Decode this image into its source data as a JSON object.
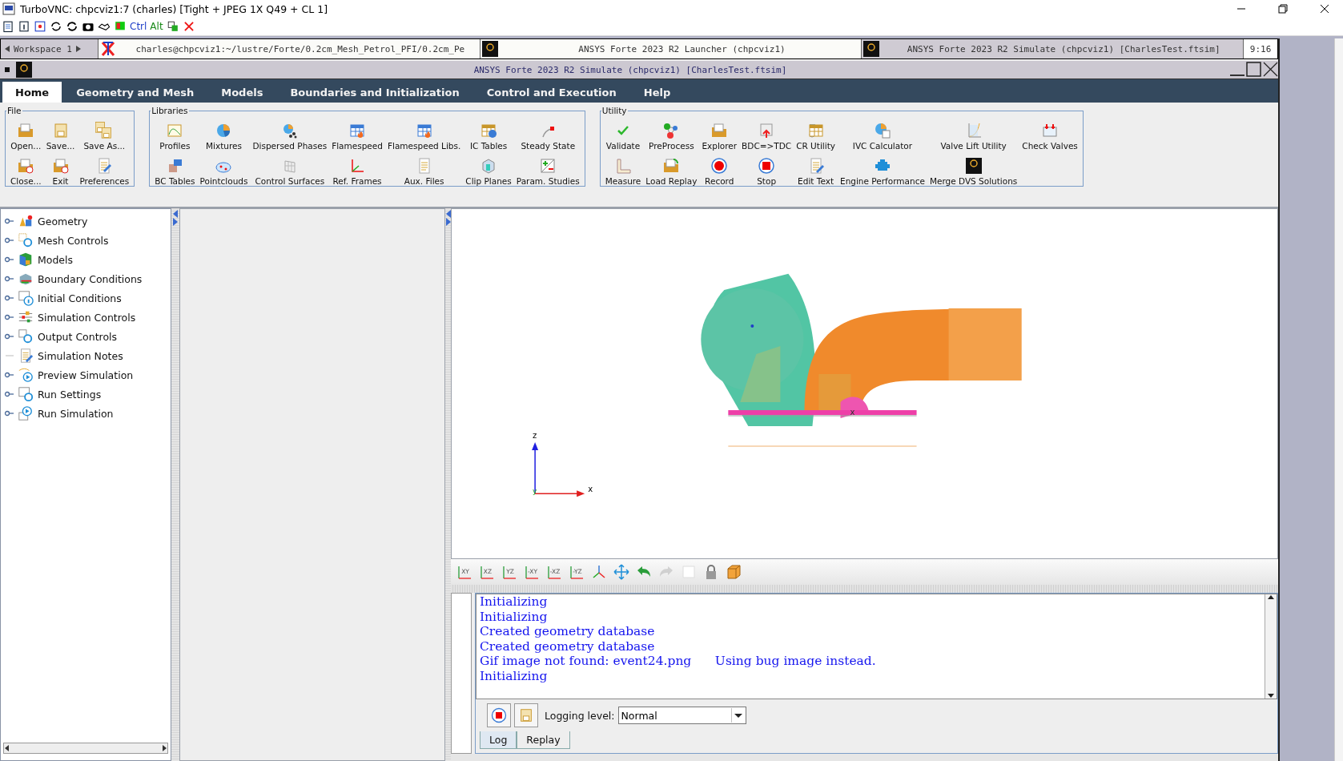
{
  "vnc_window": {
    "title": "TurboVNC: chpcviz1:7 (charles) [Tight + JPEG 1X Q49 + CL 1]",
    "toolbar_keys": [
      "Ctrl",
      "Alt"
    ]
  },
  "taskbar": {
    "workspace": "Workspace 1",
    "tasks": [
      {
        "label": "charles@chpcviz1:~/lustre/Forte/0.2cm_Mesh_Petrol_PFI/0.2cm_Pe",
        "selected": false
      },
      {
        "label": "ANSYS Forte 2023 R2 Launcher (chpcviz1)",
        "selected": false
      },
      {
        "label": "ANSYS Forte 2023 R2 Simulate (chpcviz1)  [CharlesTest.ftsim]",
        "selected": true
      }
    ],
    "clock": "9:16"
  },
  "app_window": {
    "title": "ANSYS Forte 2023 R2 Simulate (chpcviz1)  [CharlesTest.ftsim]"
  },
  "menu": [
    {
      "label": "Home",
      "selected": true
    },
    {
      "label": "Geometry and Mesh",
      "selected": false
    },
    {
      "label": "Models",
      "selected": false
    },
    {
      "label": "Boundaries and Initialization",
      "selected": false
    },
    {
      "label": "Control and Execution",
      "selected": false
    },
    {
      "label": "Help",
      "selected": false
    }
  ],
  "ribbon": [
    {
      "title": "File",
      "items": [
        "Open...",
        "Save...",
        "Save As...",
        "Close...",
        "Exit",
        "Preferences"
      ]
    },
    {
      "title": "Libraries",
      "items": [
        "Profiles",
        "Mixtures",
        "Dispersed Phases",
        "Flamespeed",
        "Flamespeed Libs.",
        "IC Tables",
        "Steady State",
        "BC Tables",
        "Pointclouds",
        "Control Surfaces",
        "Ref. Frames",
        "Aux. Files",
        "Clip Planes",
        "Param. Studies"
      ]
    },
    {
      "title": "Utility",
      "items": [
        "Validate",
        "PreProcess",
        "Explorer",
        "BDC=>TDC",
        "CR Utility",
        "IVC Calculator",
        "Valve Lift Utility",
        "Check Valves",
        "Measure",
        "Load Replay",
        "Record",
        "Stop",
        "Edit Text",
        "Engine Performance",
        "Merge DVS Solutions"
      ]
    }
  ],
  "tree": [
    {
      "label": "Geometry",
      "expandable": true
    },
    {
      "label": "Mesh Controls",
      "expandable": true
    },
    {
      "label": "Models",
      "expandable": true
    },
    {
      "label": "Boundary Conditions",
      "expandable": true
    },
    {
      "label": "Initial Conditions",
      "expandable": true
    },
    {
      "label": "Simulation Controls",
      "expandable": true
    },
    {
      "label": "Output Controls",
      "expandable": true
    },
    {
      "label": "Simulation Notes",
      "expandable": false
    },
    {
      "label": "Preview Simulation",
      "expandable": true
    },
    {
      "label": "Run Settings",
      "expandable": true
    },
    {
      "label": "Run Simulation",
      "expandable": true
    }
  ],
  "viewport": {
    "axes": {
      "z": "z",
      "y": "y",
      "x": "x"
    },
    "marker": "x"
  },
  "view_toolbar": [
    {
      "kind": "view",
      "label": "XY",
      "disabled": false
    },
    {
      "kind": "view",
      "label": "XZ",
      "disabled": false
    },
    {
      "kind": "view",
      "label": "YZ",
      "disabled": false
    },
    {
      "kind": "view",
      "label": "-XY",
      "disabled": false
    },
    {
      "kind": "view",
      "label": "-XZ",
      "disabled": false
    },
    {
      "kind": "view",
      "label": "-YZ",
      "disabled": false
    },
    {
      "kind": "triad",
      "disabled": false
    },
    {
      "kind": "pan",
      "disabled": false
    },
    {
      "kind": "undo",
      "disabled": false
    },
    {
      "kind": "redo",
      "disabled": true
    },
    {
      "kind": "blank",
      "disabled": false
    },
    {
      "kind": "lock",
      "disabled": false
    },
    {
      "kind": "box",
      "disabled": false
    }
  ],
  "log": {
    "lines": [
      "Initializing",
      "Initializing",
      "Created geometry database",
      "Created geometry database",
      "Gif image not found: event24.png      Using bug image instead.",
      "Initializing"
    ],
    "level_label": "Logging level:",
    "level": "Normal",
    "tabs": [
      {
        "label": "Log",
        "selected": true
      },
      {
        "label": "Replay",
        "selected": false
      }
    ]
  }
}
